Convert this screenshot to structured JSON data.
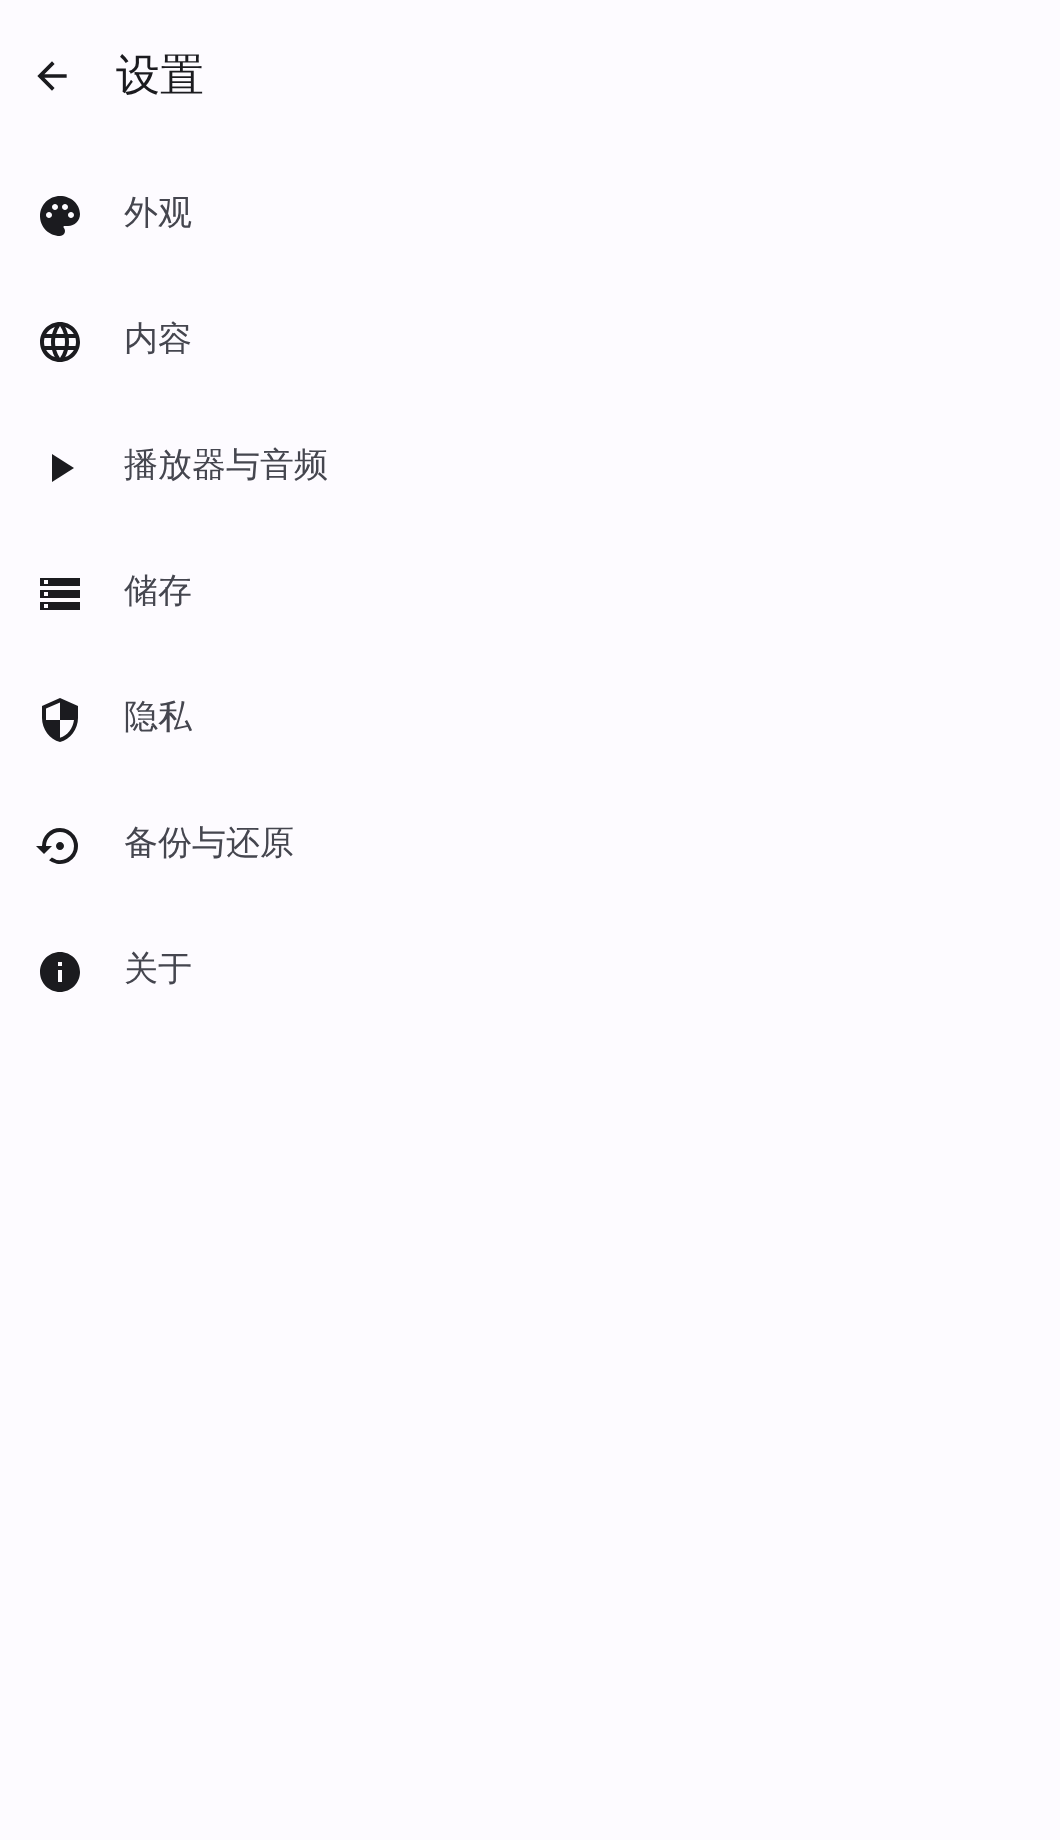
{
  "header": {
    "title": "设置"
  },
  "items": [
    {
      "label": "外观"
    },
    {
      "label": "内容"
    },
    {
      "label": "播放器与音频"
    },
    {
      "label": "储存"
    },
    {
      "label": "隐私"
    },
    {
      "label": "备份与还原"
    },
    {
      "label": "关于"
    }
  ]
}
